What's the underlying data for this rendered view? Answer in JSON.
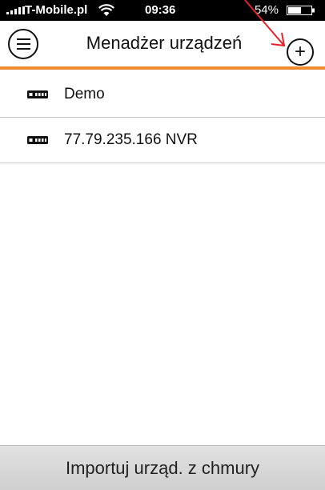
{
  "status_bar": {
    "carrier": "T-Mobile.pl",
    "time": "09:36",
    "battery_percent": "54%",
    "icons": [
      "signal-icon",
      "wifi-icon",
      "battery-icon"
    ]
  },
  "header": {
    "title": "Menadżer urządzeń",
    "menu_icon": "hamburger-icon",
    "add_icon": "plus-icon",
    "add_glyph": "+",
    "accent_color": "#f08a2e",
    "annotation_arrow_color": "#e8202a"
  },
  "devices": [
    {
      "label": "Demo",
      "icon": "recorder-icon"
    },
    {
      "label": "77.79.235.166 NVR",
      "icon": "recorder-icon"
    }
  ],
  "footer": {
    "import_label": "Importuj urząd. z chmury"
  }
}
